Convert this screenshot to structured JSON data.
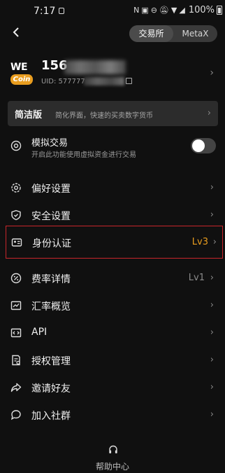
{
  "status_bar": {
    "time": "7:17",
    "battery": "100%"
  },
  "header": {
    "tabs": [
      {
        "label": "交易所",
        "active": true
      },
      {
        "label": "MetaX",
        "active": false
      }
    ]
  },
  "profile": {
    "name": "156",
    "uid": "UID: 577777",
    "avatar_text_top": "WE",
    "avatar_text_bottom": "Coin"
  },
  "banner": {
    "title": "简洁版",
    "subtitle": "简化界面，快速的买卖数字货币"
  },
  "simulated": {
    "title": "模拟交易",
    "subtitle": "开启此功能使用虚拟资金进行交易",
    "enabled": false
  },
  "menu": [
    {
      "label": "偏好设置",
      "icon": "settings-icon"
    },
    {
      "label": "安全设置",
      "icon": "shield-icon"
    },
    {
      "label": "身份认证",
      "icon": "id-card-icon",
      "value": "Lv3",
      "value_color": "#e99d1f"
    },
    {
      "label": "费率详情",
      "icon": "percent-icon",
      "value": "Lv1",
      "value_color": "#8a8a8a"
    },
    {
      "label": "汇率概览",
      "icon": "chart-icon"
    },
    {
      "label": "API",
      "icon": "code-icon"
    },
    {
      "label": "授权管理",
      "icon": "authorize-icon"
    },
    {
      "label": "邀请好友",
      "icon": "share-icon"
    },
    {
      "label": "加入社群",
      "icon": "chat-icon"
    }
  ],
  "footer": {
    "help_label": "帮助中心"
  },
  "colors": {
    "background": "#101010",
    "accent": "#e99d1f",
    "highlight_border": "#c8262b"
  }
}
